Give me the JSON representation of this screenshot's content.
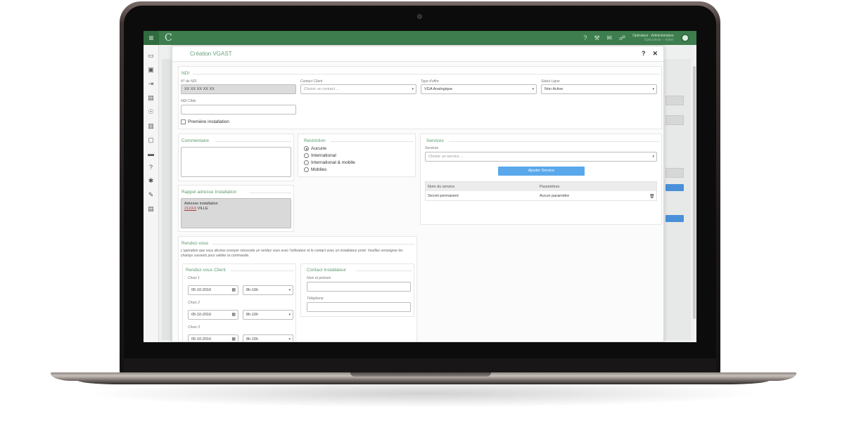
{
  "app": {
    "logo": "C",
    "topbar": {
      "help_icon": "?",
      "search_icon": "⚒",
      "user_name": "Opérateur - Administrateur",
      "user_sub": "Spécialiste – éditer"
    }
  },
  "modal": {
    "title": "Création VGAST",
    "help": "?",
    "close": "✕",
    "ndi": {
      "section_title": "NDI",
      "ndi_label": "N° de NDI",
      "ndi_value": "XX XX XX XX XX",
      "contact_label": "Contact Client",
      "contact_placeholder": "Choisir un contact ...",
      "offer_label": "Type d'offre",
      "offer_value": "VGA Analogique",
      "status_label": "Statut Ligne",
      "status_value": "Non Active",
      "target_label": "NDI Cible",
      "target_value": "",
      "first_install_label": "Première installation"
    },
    "comment": {
      "title": "Commentaire"
    },
    "restriction": {
      "title": "Restriction",
      "options": [
        "Aucune",
        "International",
        "International & mobile",
        "Mobiles"
      ],
      "selected": "Aucune"
    },
    "services": {
      "title": "Services",
      "field_label": "Services",
      "placeholder": "Choisir un service ...",
      "add_button": "Ajouter Service",
      "col_name": "Nom du service",
      "col_params": "Paramètres",
      "rows": [
        {
          "name": "Secret permanent",
          "params": "Aucun paramètre"
        }
      ]
    },
    "address": {
      "title": "Rappel adresse Installation",
      "line1": "Adresse installation",
      "postcode": "21XXX",
      "city": "VILLE"
    },
    "rdv": {
      "title": "Rendez-vous",
      "description": "L'opération que vous désirez envoyer nécessite un rendez vous avec l'utilisateur et le contact avec un installateur privé. Veuillez renseigner les champs suivants pour valider la commande.",
      "client_title": "Rendez-vous Client",
      "choices": [
        {
          "label": "Choix 1",
          "date": "05-10-2016",
          "slot": "8h-10h"
        },
        {
          "label": "Choix 2",
          "date": "05-10-2016",
          "slot": "8h-10h"
        },
        {
          "label": "Choix 3",
          "date": "05-10-2016",
          "slot": "8h-10h"
        }
      ],
      "installer_title": "Contact Installateur",
      "name_label": "Nom et prénom",
      "phone_label": "Téléphone"
    }
  }
}
